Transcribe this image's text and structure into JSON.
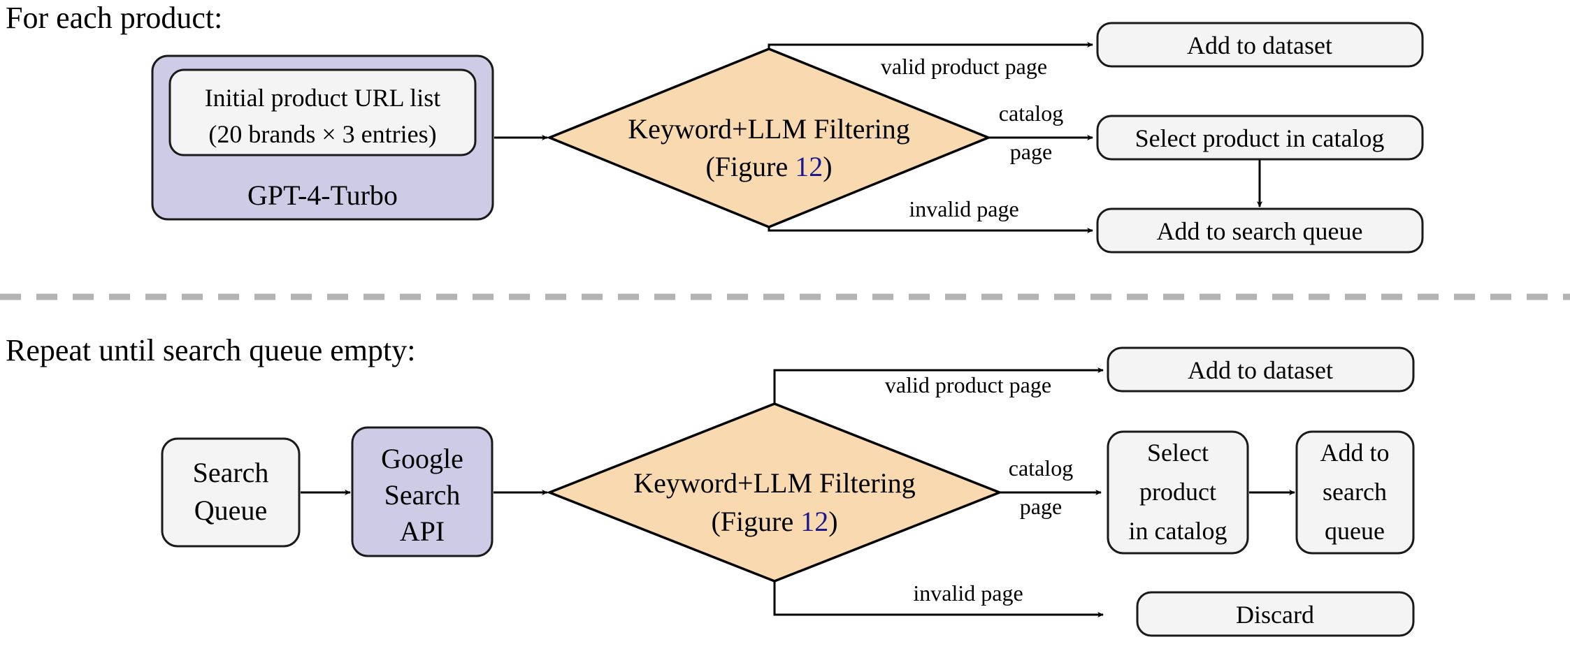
{
  "figure": {
    "title_phase1": "For each product:",
    "title_phase2": "Repeat until search queue empty:",
    "colors": {
      "decision_fill": "#f8d9b0",
      "llm_box_fill": "#cdcbe6",
      "plain_box_fill": "#f4f4f4",
      "stroke": "#000000",
      "divider": "#b3b3b3",
      "figure_reference_link": "#1a1a8c"
    }
  },
  "phase1": {
    "seed_node": {
      "outer_label": "GPT-4-Turbo",
      "inner_line1": "Initial product URL list",
      "inner_line2": "(20 brands × 3 entries)"
    },
    "decision": {
      "line1": "Keyword+LLM Filtering",
      "line2_prefix": "(Figure ",
      "line2_ref": "12",
      "line2_suffix": ")"
    },
    "edges": {
      "valid": "valid product page",
      "catalog_line1": "catalog",
      "catalog_line2": "page",
      "invalid": "invalid page"
    },
    "outputs": {
      "valid_box": "Add to dataset",
      "catalog_box": "Select product in catalog",
      "invalid_box": "Add to search queue"
    }
  },
  "phase2": {
    "queue_node": {
      "line1": "Search",
      "line2": "Queue"
    },
    "search_api_node": {
      "line1": "Google",
      "line2": "Search",
      "line3": "API"
    },
    "decision": {
      "line1": "Keyword+LLM Filtering",
      "line2_prefix": "(Figure ",
      "line2_ref": "12",
      "line2_suffix": ")"
    },
    "edges": {
      "valid": "valid product page",
      "catalog_line1": "catalog",
      "catalog_line2": "page",
      "invalid": "invalid page"
    },
    "outputs": {
      "valid_box": "Add to dataset",
      "catalog_box_line1": "Select",
      "catalog_box_line2": "product",
      "catalog_box_line3": "in catalog",
      "queue_box_line1": "Add to",
      "queue_box_line2": "search",
      "queue_box_line3": "queue",
      "invalid_box": "Discard"
    }
  }
}
